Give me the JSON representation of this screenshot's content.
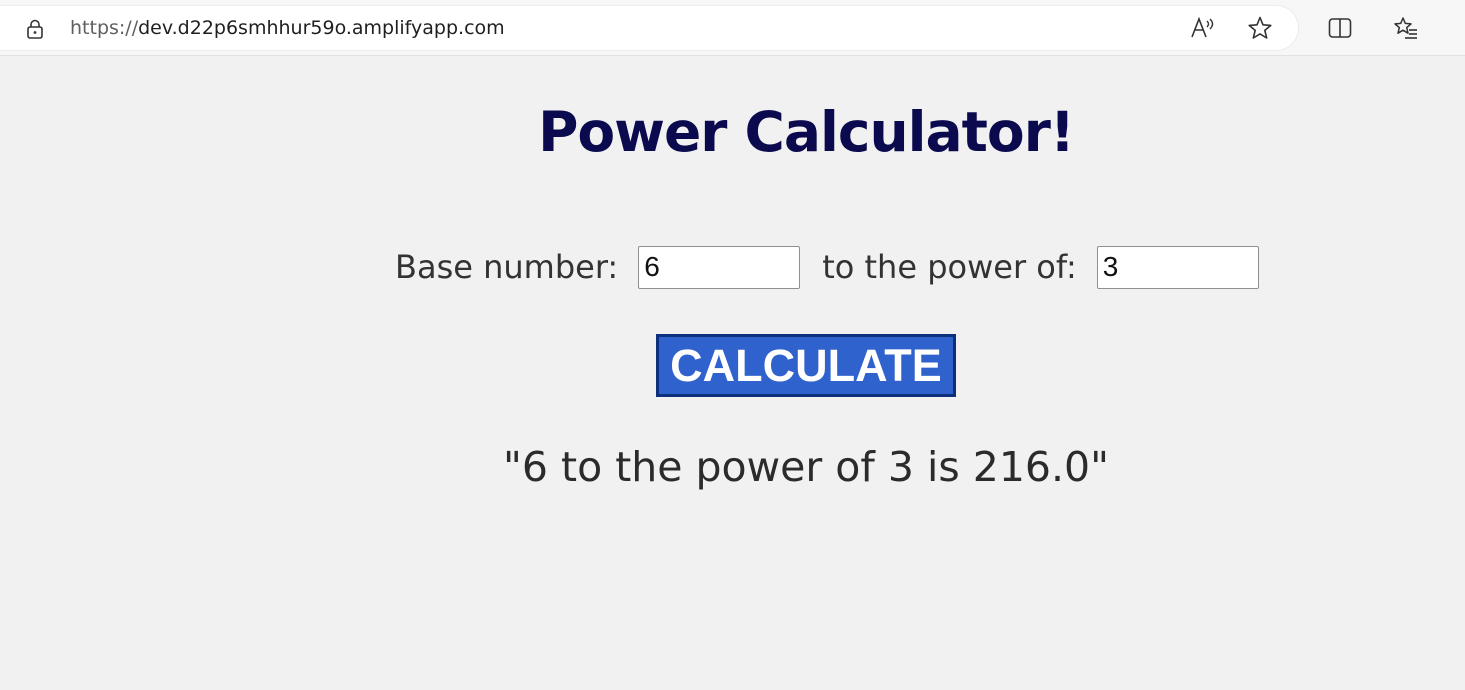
{
  "browser": {
    "url_scheme": "https://",
    "url_host": "dev.d22p6smhhur59o.amplifyapp.com",
    "icons": [
      "lock-icon",
      "read-aloud-icon",
      "favorite-star-icon",
      "split-screen-icon",
      "favorites-list-icon"
    ]
  },
  "page": {
    "title": "Power Calculator!",
    "base_label": "Base number:",
    "base_value": "6",
    "power_label": "to the power of:",
    "power_value": "3",
    "calculate_label": "CALCULATE",
    "result_text": "\"6 to the power of 3 is 216.0\""
  },
  "colors": {
    "title": "#0b0a4e",
    "button_bg": "#2f62cc",
    "button_border": "#0d2f7c",
    "page_bg": "#f1f1f1"
  }
}
